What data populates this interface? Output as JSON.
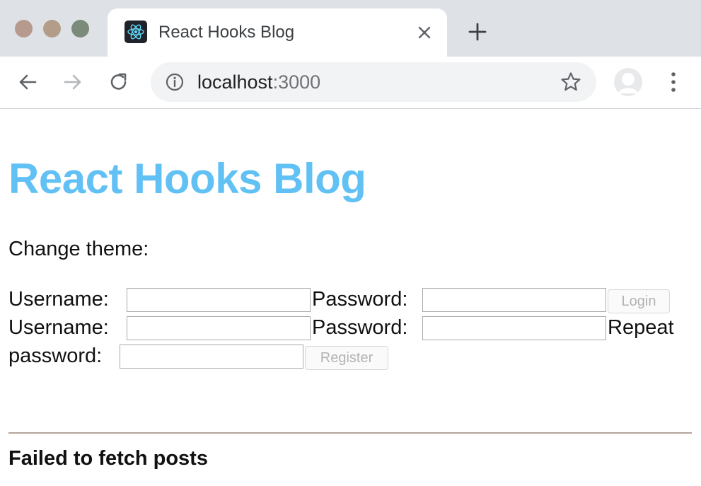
{
  "browser": {
    "tab_title": "React Hooks Blog",
    "url_host": "localhost",
    "url_port": ":3000",
    "favicon": "react-icon"
  },
  "page": {
    "title": "React Hooks Blog",
    "theme_label": "Change theme:",
    "login": {
      "username_label": "Username:",
      "password_label": "Password:",
      "button_label": "Login"
    },
    "register": {
      "username_label": "Username:",
      "password_label": "Password:",
      "repeat_label_line1": "Repeat",
      "repeat_label_line2": "password:",
      "button_label": "Register"
    },
    "error_message": "Failed to fetch posts"
  },
  "colors": {
    "title_accent": "#61c1f5",
    "tabstrip_bg": "#dee1e6"
  }
}
